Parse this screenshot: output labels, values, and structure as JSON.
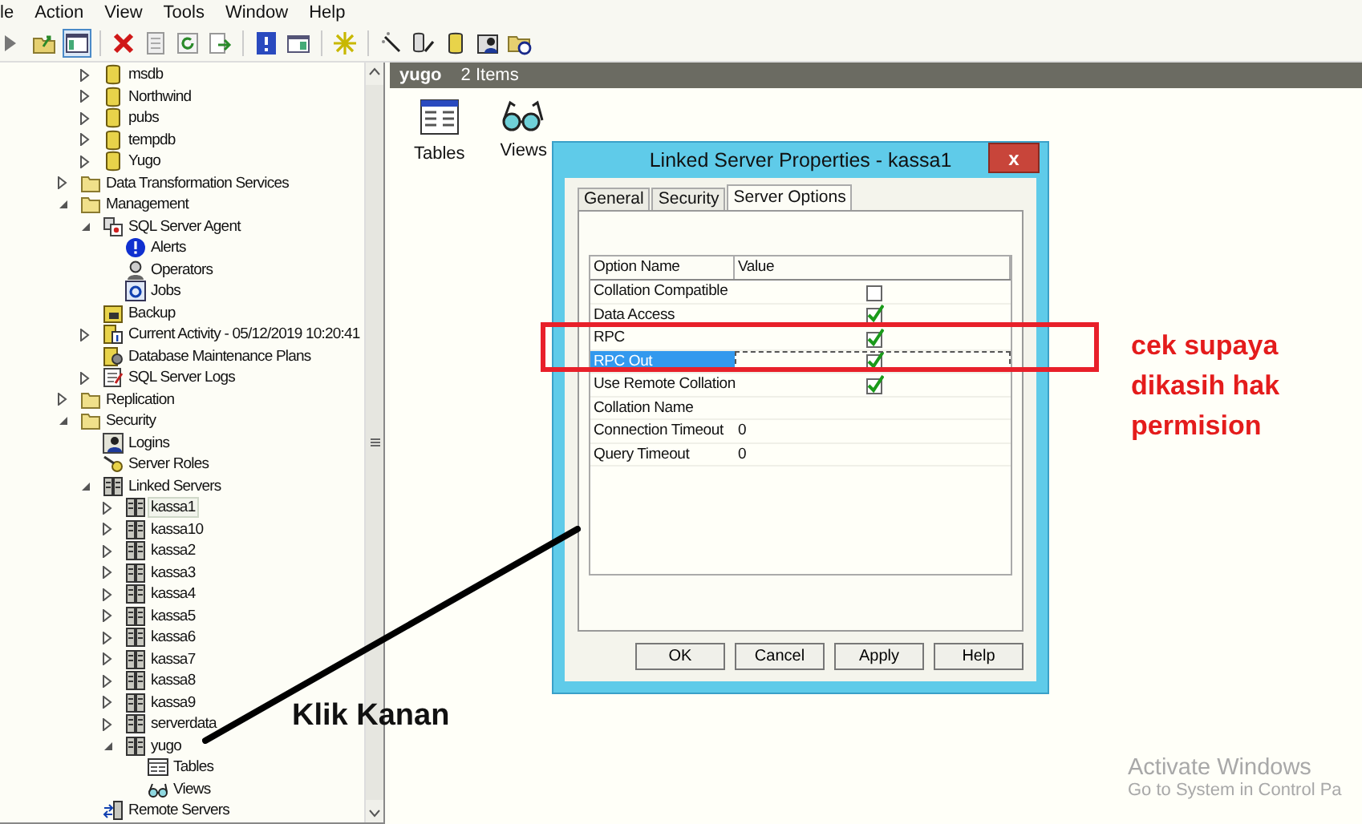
{
  "menu": [
    "le",
    "Action",
    "View",
    "Tools",
    "Window",
    "Help"
  ],
  "tree": {
    "partial_children": [
      {
        "label": "msdb",
        "kind": "database",
        "expanded": false,
        "selected": false
      },
      {
        "label": "Northwind",
        "kind": "database",
        "expanded": false,
        "selected": false
      },
      {
        "label": "pubs",
        "kind": "database",
        "expanded": false,
        "selected": false
      },
      {
        "label": "tempdb",
        "kind": "database",
        "expanded": false,
        "selected": false
      },
      {
        "label": "Yugo",
        "kind": "database",
        "expanded": false,
        "selected": false
      }
    ],
    "items": [
      {
        "label": "Data Transformation Services",
        "kind": "folder",
        "expanded": false,
        "selected": false
      },
      {
        "label": "Management",
        "kind": "folder",
        "expanded": true,
        "selected": false,
        "children": [
          {
            "label": "SQL Server Agent",
            "kind": "agent",
            "expanded": true,
            "selected": false,
            "children": [
              {
                "label": "Alerts",
                "kind": "alert",
                "selected": false
              },
              {
                "label": "Operators",
                "kind": "operator",
                "selected": false
              },
              {
                "label": "Jobs",
                "kind": "job",
                "selected": false
              }
            ]
          },
          {
            "label": "Backup",
            "kind": "backup",
            "selected": false
          },
          {
            "label": "Current Activity - 05/12/2019 10:20:41",
            "kind": "activity",
            "expanded": false,
            "selected": false
          },
          {
            "label": "Database Maintenance Plans",
            "kind": "plans",
            "selected": false
          },
          {
            "label": "SQL Server Logs",
            "kind": "logs",
            "expanded": false,
            "selected": false
          }
        ]
      },
      {
        "label": "Replication",
        "kind": "folder",
        "expanded": false,
        "selected": false
      },
      {
        "label": "Security",
        "kind": "folder",
        "expanded": true,
        "selected": false,
        "children": [
          {
            "label": "Logins",
            "kind": "login",
            "selected": false
          },
          {
            "label": "Server Roles",
            "kind": "roles",
            "selected": false
          },
          {
            "label": "Linked Servers",
            "kind": "server",
            "expanded": true,
            "selected": false,
            "children": [
              {
                "label": "kassa1",
                "kind": "server",
                "expanded": false,
                "selected": true
              },
              {
                "label": "kassa10",
                "kind": "server",
                "expanded": false,
                "selected": false
              },
              {
                "label": "kassa2",
                "kind": "server",
                "expanded": false,
                "selected": false
              },
              {
                "label": "kassa3",
                "kind": "server",
                "expanded": false,
                "selected": false
              },
              {
                "label": "kassa4",
                "kind": "server",
                "expanded": false,
                "selected": false
              },
              {
                "label": "kassa5",
                "kind": "server",
                "expanded": false,
                "selected": false
              },
              {
                "label": "kassa6",
                "kind": "server",
                "expanded": false,
                "selected": false
              },
              {
                "label": "kassa7",
                "kind": "server",
                "expanded": false,
                "selected": false
              },
              {
                "label": "kassa8",
                "kind": "server",
                "expanded": false,
                "selected": false
              },
              {
                "label": "kassa9",
                "kind": "server",
                "expanded": false,
                "selected": false
              },
              {
                "label": "serverdata",
                "kind": "server",
                "expanded": false,
                "selected": false
              },
              {
                "label": "yugo",
                "kind": "server",
                "expanded": true,
                "selected": false,
                "children": [
                  {
                    "label": "Tables",
                    "kind": "table",
                    "selected": false
                  },
                  {
                    "label": "Views",
                    "kind": "view",
                    "selected": false
                  }
                ]
              }
            ]
          },
          {
            "label": "Remote Servers",
            "kind": "remote",
            "selected": false
          }
        ]
      }
    ]
  },
  "details": {
    "title": "yugo",
    "count": "2 Items",
    "items": [
      {
        "label": "Tables",
        "kind": "table"
      },
      {
        "label": "Views",
        "kind": "view"
      }
    ]
  },
  "dialog": {
    "title": "Linked Server Properties - kassa1",
    "close": "x",
    "tabs": [
      {
        "label": "General",
        "selected": false
      },
      {
        "label": "Security",
        "selected": false
      },
      {
        "label": "Server Options",
        "selected": true
      }
    ],
    "columns": [
      "Option Name",
      "Value"
    ],
    "rows": [
      {
        "name": "Collation Compatible",
        "kind": "checkbox",
        "checked": false,
        "selected": false
      },
      {
        "name": "Data Access",
        "kind": "checkbox",
        "checked": true,
        "selected": false
      },
      {
        "name": "RPC",
        "kind": "checkbox",
        "checked": true,
        "selected": false
      },
      {
        "name": "RPC Out",
        "kind": "checkbox",
        "checked": true,
        "selected": true
      },
      {
        "name": "Use Remote Collation",
        "kind": "checkbox",
        "checked": true,
        "selected": false
      },
      {
        "name": "Collation Name",
        "kind": "text",
        "selected": false
      },
      {
        "name": "Connection Timeout",
        "kind": "text",
        "value": "0",
        "selected": false
      },
      {
        "name": "Query Timeout",
        "kind": "text",
        "value": "0",
        "selected": false
      }
    ],
    "buttons": [
      "OK",
      "Cancel",
      "Apply",
      "Help"
    ]
  },
  "annotations": {
    "note": "cek supaya dikasih hak permision",
    "pointer_label": "Klik Kanan"
  },
  "activation": {
    "title": "Activate Windows",
    "subtitle": "Go to System in Control Pa"
  }
}
